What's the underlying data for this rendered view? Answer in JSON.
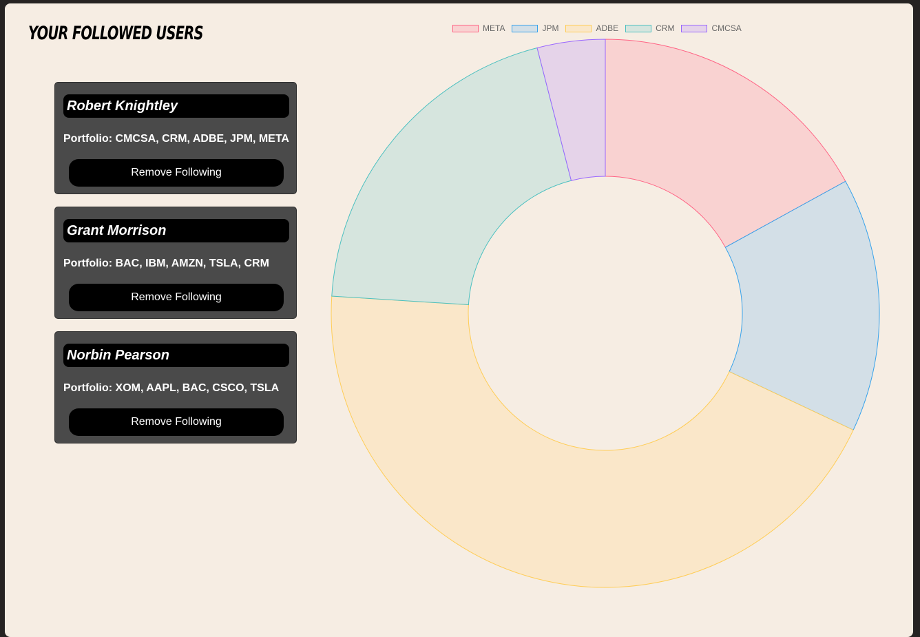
{
  "page": {
    "heading": "YOUR FOLLOWED USERS"
  },
  "users": [
    {
      "name": "Robert Knightley",
      "portfolio": "Portfolio: CMCSA, CRM, ADBE, JPM, META",
      "button_label": "Remove Following"
    },
    {
      "name": "Grant Morrison",
      "portfolio": "Portfolio: BAC, IBM, AMZN, TSLA, CRM",
      "button_label": "Remove Following"
    },
    {
      "name": "Norbin Pearson",
      "portfolio": "Portfolio: XOM, AAPL, BAC, CSCO, TSLA",
      "button_label": "Remove Following"
    }
  ],
  "chart_data": {
    "type": "pie",
    "variant": "doughnut",
    "categories": [
      "META",
      "JPM",
      "ADBE",
      "CRM",
      "CMCSA"
    ],
    "values": [
      17,
      15,
      44,
      20,
      4
    ],
    "unit": "%",
    "fill_colors": [
      "#f9d2d1",
      "#d3dfe7",
      "#fae7c9",
      "#d6e5de",
      "#e5d3e9"
    ],
    "border_colors": [
      "#ff6384",
      "#36a2eb",
      "#ffcd56",
      "#4bc0c0",
      "#9966ff"
    ],
    "legend_position": "top",
    "title": ""
  }
}
